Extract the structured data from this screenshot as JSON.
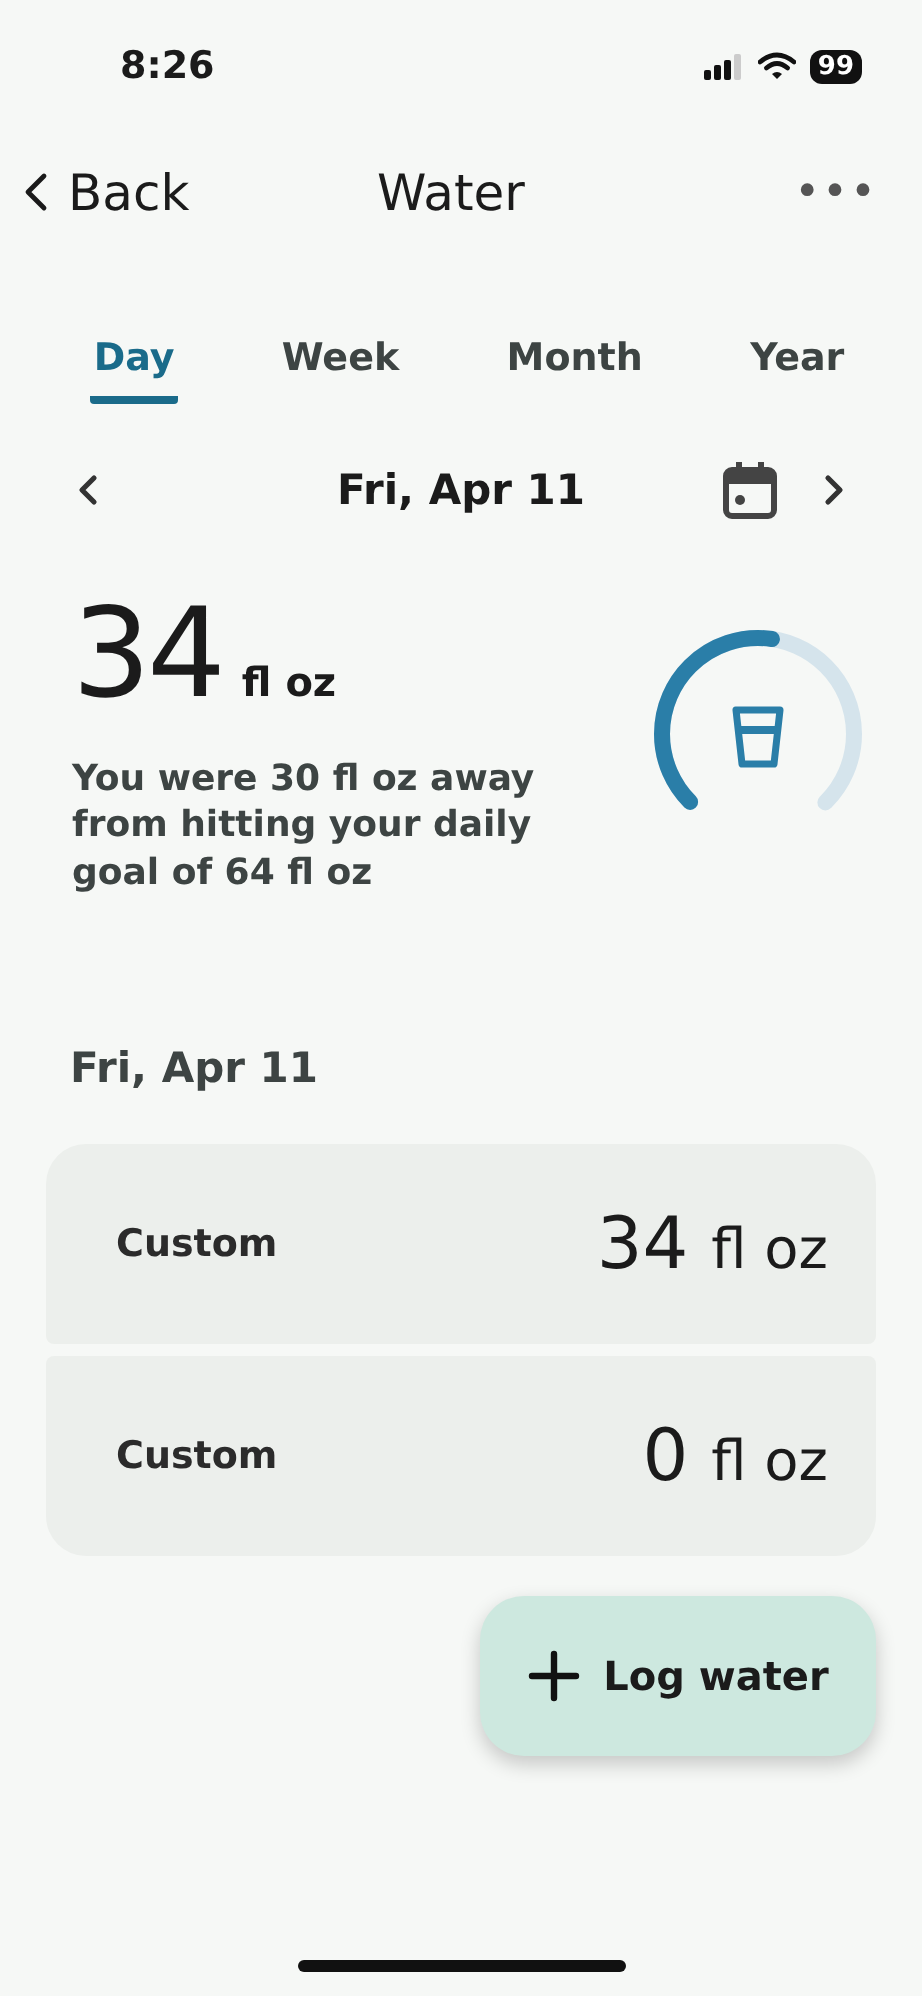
{
  "status_bar": {
    "time": "8:26",
    "battery": "99"
  },
  "nav": {
    "back": "Back",
    "title": "Water",
    "more": "•••"
  },
  "tabs": [
    {
      "label": "Day",
      "selected": true
    },
    {
      "label": "Week",
      "selected": false
    },
    {
      "label": "Month",
      "selected": false
    },
    {
      "label": "Year",
      "selected": false
    }
  ],
  "date_nav": {
    "date": "Fri, Apr 11"
  },
  "summary": {
    "amount": "34",
    "unit": "fl oz",
    "message": "You were 30 fl oz away from hitting your daily goal of 64 fl oz",
    "level": 0.53
  },
  "section_title": "Fri, Apr 11",
  "entries": [
    {
      "label": "Custom",
      "amount": "34",
      "unit": "fl oz"
    },
    {
      "label": "Custom",
      "amount": "0",
      "unit": "fl oz"
    }
  ],
  "fab": {
    "label": "Log water"
  }
}
